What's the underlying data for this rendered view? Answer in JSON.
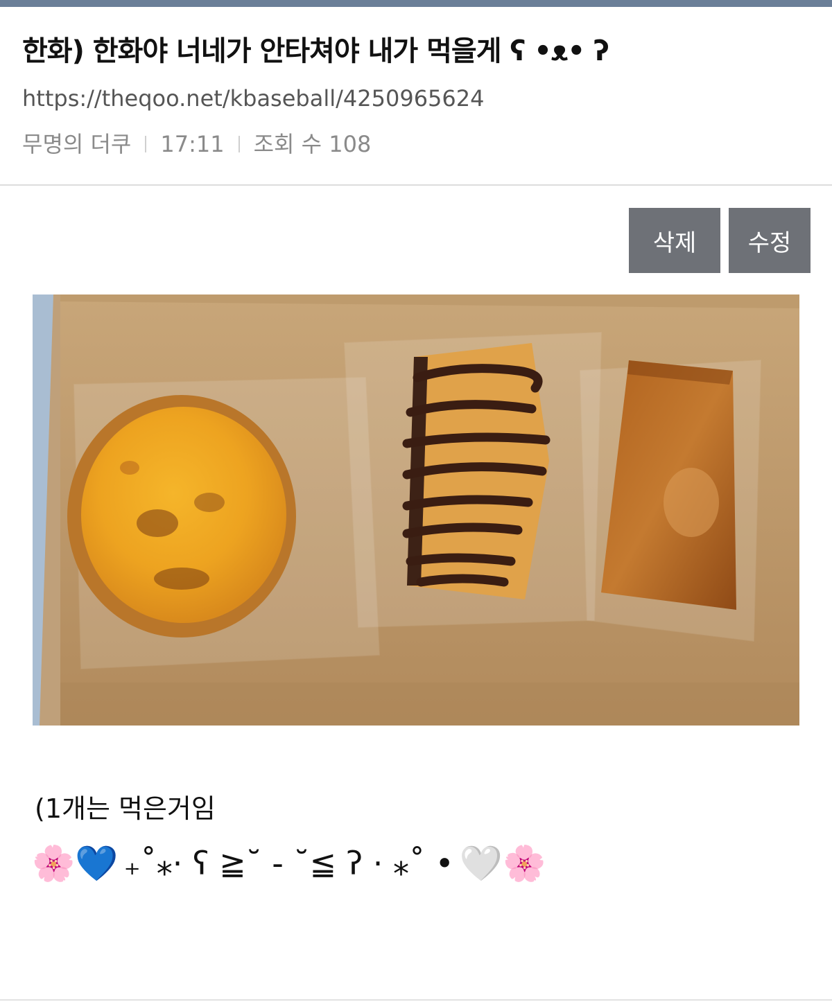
{
  "post": {
    "title": "한화) 한화야 너네가 안타쳐야 내가 먹을게 ʕ •ᴥ• ʔ",
    "url": "https://theqoo.net/kbaseball/4250965624",
    "author": "무명의 더쿠",
    "time": "17:11",
    "views": "조회 수 108"
  },
  "actions": {
    "delete_label": "삭제",
    "edit_label": "수정"
  },
  "content": {
    "text": "(1개는 먹은거임",
    "emoji_left": "🌸💙",
    "kaomoji": "₊˚⁎⋅ ʕ ≧˘ - ˘≦ ʔ ⋅ ⁎˚ •",
    "emoji_right": "🤍🌸"
  },
  "colors": {
    "top_bar": "#6b7f98",
    "button_bg": "#6e7177",
    "meta_text": "#8a8a8a",
    "url_text": "#555555"
  },
  "icons": [
    "photo-egg-tart",
    "photo-chocolate-pastry",
    "photo-pound-cake"
  ]
}
